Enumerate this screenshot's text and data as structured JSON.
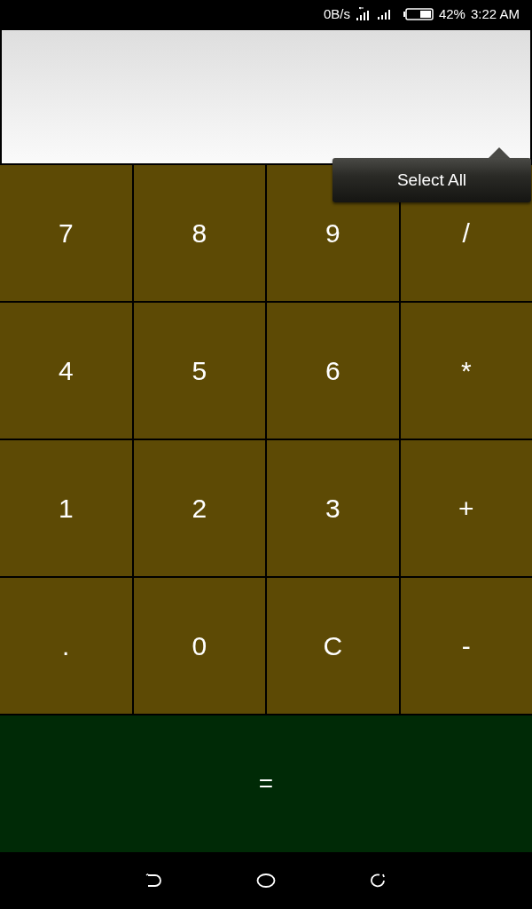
{
  "status_bar": {
    "speed": "0B/s",
    "battery": "42%",
    "time": "3:22 AM"
  },
  "context_menu": {
    "label": "Select All"
  },
  "keys": [
    {
      "label": "7"
    },
    {
      "label": "8"
    },
    {
      "label": "9"
    },
    {
      "label": "/"
    },
    {
      "label": "4"
    },
    {
      "label": "5"
    },
    {
      "label": "6"
    },
    {
      "label": "*"
    },
    {
      "label": "1"
    },
    {
      "label": "2"
    },
    {
      "label": "3"
    },
    {
      "label": "+"
    },
    {
      "label": "."
    },
    {
      "label": "0"
    },
    {
      "label": "C"
    },
    {
      "label": "-"
    }
  ],
  "equals": {
    "label": "="
  }
}
